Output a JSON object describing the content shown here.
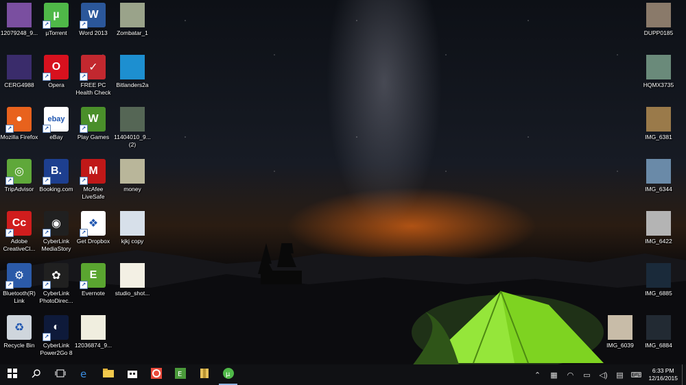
{
  "desktop_icons_left": [
    {
      "label": "12079248_9...",
      "kind": "thumb",
      "color": "#7a4fa0",
      "icon": "image-thumbnail-icon"
    },
    {
      "label": "µTorrent",
      "kind": "app",
      "color": "#4fb848",
      "glyph": "µ",
      "icon": "utorrent-icon"
    },
    {
      "label": "Word 2013",
      "kind": "app",
      "color": "#2b579a",
      "glyph": "W",
      "icon": "word-icon"
    },
    {
      "label": "Zombatar_1",
      "kind": "thumb",
      "color": "#9aa38a",
      "icon": "zombie-image-icon"
    },
    {
      "label": "CERG4988",
      "kind": "thumb",
      "color": "#3a2c6b",
      "icon": "image-thumbnail-icon"
    },
    {
      "label": "Opera",
      "kind": "app",
      "color": "#d7111e",
      "glyph": "O",
      "icon": "opera-icon"
    },
    {
      "label": "FREE PC Health Check",
      "kind": "app",
      "color": "#c2282f",
      "glyph": "✓",
      "icon": "pc-health-check-icon"
    },
    {
      "label": "Bitlanders2a",
      "kind": "thumb",
      "color": "#1d8fd0",
      "icon": "image-thumbnail-icon"
    },
    {
      "label": "Mozilla Firefox",
      "kind": "app",
      "color": "#e8621d",
      "glyph": "●",
      "icon": "firefox-icon"
    },
    {
      "label": "eBay",
      "kind": "app",
      "color": "#ffffff",
      "glyph": "ebay",
      "icon": "ebay-icon"
    },
    {
      "label": "Play Games",
      "kind": "app",
      "color": "#4a8f2a",
      "glyph": "W",
      "icon": "play-games-icon"
    },
    {
      "label": "11404010_9... (2)",
      "kind": "thumb",
      "color": "#556655",
      "icon": "image-thumbnail-icon"
    },
    {
      "label": "TripAdvisor",
      "kind": "app",
      "color": "#5fa83a",
      "glyph": "◎",
      "icon": "tripadvisor-icon"
    },
    {
      "label": "Booking.com",
      "kind": "app",
      "color": "#1d3f8f",
      "glyph": "B.",
      "icon": "booking-icon"
    },
    {
      "label": "McAfee LiveSafe",
      "kind": "app",
      "color": "#c01818",
      "glyph": "M",
      "icon": "mcafee-icon"
    },
    {
      "label": "money",
      "kind": "thumb",
      "color": "#b9b69a",
      "icon": "image-thumbnail-icon"
    },
    {
      "label": "Adobe CreativeCl...",
      "kind": "app",
      "color": "#d01d1d",
      "glyph": "Cc",
      "icon": "adobe-cc-icon"
    },
    {
      "label": "CyberLink MediaStory",
      "kind": "app",
      "color": "#202020",
      "glyph": "◉",
      "icon": "mediastory-icon"
    },
    {
      "label": "Get Dropbox",
      "kind": "app",
      "color": "#ffffff",
      "glyph": "❖",
      "icon": "dropbox-icon"
    },
    {
      "label": "kjkj copy",
      "kind": "thumb",
      "color": "#d7e0ea",
      "icon": "image-thumbnail-icon"
    },
    {
      "label": "Bluetooth(R) Link",
      "kind": "app",
      "color": "#2b5aa8",
      "glyph": "⚙",
      "icon": "bluetooth-link-icon"
    },
    {
      "label": "CyberLink PhotoDirec...",
      "kind": "app",
      "color": "#202020",
      "glyph": "✿",
      "icon": "photodirector-icon"
    },
    {
      "label": "Evernote",
      "kind": "app",
      "color": "#5aa530",
      "glyph": "E",
      "icon": "evernote-icon"
    },
    {
      "label": "studio_shot...",
      "kind": "thumb",
      "color": "#f3f0e4",
      "icon": "coin-image-icon"
    },
    {
      "label": "Recycle Bin",
      "kind": "app",
      "color": "#cfd6dd",
      "glyph": "♻",
      "icon": "recycle-bin-icon"
    },
    {
      "label": "CyberLink Power2Go 8",
      "kind": "app",
      "color": "#0e1a3a",
      "glyph": "◐",
      "icon": "power2go-icon"
    },
    {
      "label": "12036874_9...",
      "kind": "thumb",
      "color": "#f0eedf",
      "icon": "flower-image-icon"
    }
  ],
  "desktop_icons_right": [
    {
      "label": "DUPP0185",
      "color": "#8a7a6a"
    },
    {
      "label": "HQMX3735",
      "color": "#6a8a7a"
    },
    {
      "label": "IMG_6381",
      "color": "#9a7a4a"
    },
    {
      "label": "IMG_6344",
      "color": "#6a8aa8"
    },
    {
      "label": "IMG_6422",
      "color": "#b4b4b4"
    },
    {
      "label": "IMG_6885",
      "color": "#1a2a3a"
    },
    {
      "label": "IMG_6039",
      "color": "#c8bca8"
    },
    {
      "label": "IMG_6884",
      "color": "#222a33"
    }
  ],
  "taskbar": {
    "items": [
      {
        "name": "start-button",
        "icon": "windows-logo-icon",
        "active": false
      },
      {
        "name": "search-button",
        "icon": "search-icon",
        "active": false
      },
      {
        "name": "task-view-button",
        "icon": "task-view-icon",
        "active": false
      },
      {
        "name": "edge-button",
        "icon": "edge-icon",
        "active": false
      },
      {
        "name": "file-explorer-button",
        "icon": "folder-icon",
        "active": false
      },
      {
        "name": "store-button",
        "icon": "store-icon",
        "active": false
      },
      {
        "name": "opera-taskbar-button",
        "icon": "opera-icon",
        "active": false
      },
      {
        "name": "evernote-taskbar-button",
        "icon": "evernote-icon",
        "active": false
      },
      {
        "name": "app-taskbar-button",
        "icon": "archive-icon",
        "active": false
      },
      {
        "name": "utorrent-taskbar-button",
        "icon": "utorrent-icon",
        "active": true
      }
    ],
    "tray": {
      "time": "6:33 PM",
      "date": "12/16/2015"
    }
  }
}
